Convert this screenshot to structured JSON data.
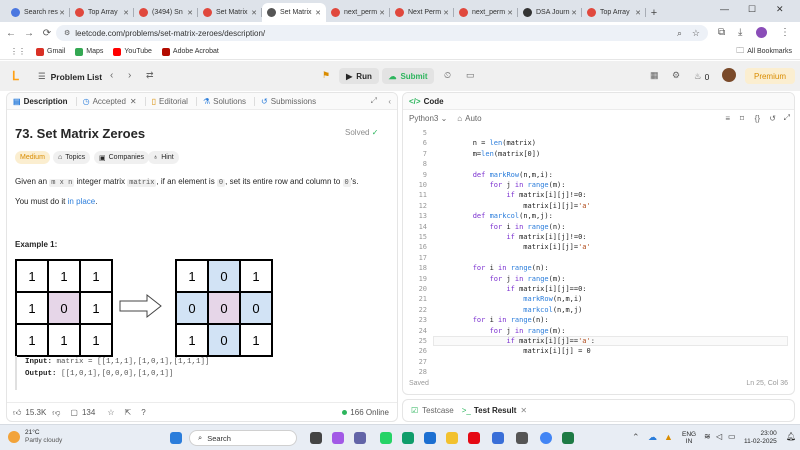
{
  "browser": {
    "tabs": [
      {
        "label": "Search res",
        "color": "#4a77e0"
      },
      {
        "label": "Top Array",
        "color": "#e0483d"
      },
      {
        "label": "(3494) Sn",
        "color": "#e0483d"
      },
      {
        "label": "Set Matrix",
        "color": "#e0483d"
      },
      {
        "label": "Set Matrix",
        "color": "#555555"
      },
      {
        "label": "next_perm",
        "color": "#e0483d"
      },
      {
        "label": "Next Perm",
        "color": "#e0483d"
      },
      {
        "label": "next_perm",
        "color": "#e0483d"
      },
      {
        "label": "DSA Journ",
        "color": "#333333"
      },
      {
        "label": "Top Array",
        "color": "#e0483d"
      }
    ],
    "active_tab_index": 4,
    "url": "leetcode.com/problems/set-matrix-zeroes/description/",
    "bookmarks": [
      {
        "label": "Gmail",
        "color": "#d93025"
      },
      {
        "label": "Maps",
        "color": "#34a853"
      },
      {
        "label": "YouTube",
        "color": "#ff0000"
      },
      {
        "label": "Adobe Acrobat",
        "color": "#b30b00"
      }
    ],
    "all_bookmarks": "All Bookmarks"
  },
  "lc_nav": {
    "problem_list": "Problem List",
    "run": "Run",
    "submit": "Submit",
    "fire_count": "0",
    "premium": "Premium"
  },
  "left": {
    "tabs": [
      "Description",
      "Accepted",
      "Editorial",
      "Solutions",
      "Submissions"
    ],
    "title": "73. Set Matrix Zeroes",
    "solved": "Solved",
    "chips": [
      "Medium",
      "Topics",
      "Companies",
      "Hint"
    ],
    "desc_1": "Given an",
    "desc_mxn": "m x n",
    "desc_2": "integer matrix",
    "desc_matrix": "matrix",
    "desc_3": ", if an element is",
    "desc_zero": "0",
    "desc_4": ", set its entire row and column to",
    "desc_zero2": "0",
    "desc_5": "'s.",
    "inplace_1": "You must do it",
    "inplace_link": "in place",
    "inplace_2": ".",
    "example_title": "Example 1:",
    "input_grid": [
      [
        "1",
        "1",
        "1"
      ],
      [
        "1",
        "0",
        "1"
      ],
      [
        "1",
        "1",
        "1"
      ]
    ],
    "output_grid": [
      [
        "1",
        "0",
        "1"
      ],
      [
        "0",
        "0",
        "0"
      ],
      [
        "1",
        "0",
        "1"
      ]
    ],
    "input_label": "Input:",
    "input_value": "matrix = [[1,1,1],[1,0,1],[1,1,1]]",
    "output_label": "Output:",
    "output_value": "[[1,0,1],[0,0,0],[1,0,1]]",
    "likes": "15.3K",
    "comments": "134",
    "online": "166 Online"
  },
  "right": {
    "code_tab": "Code",
    "language": "Python3",
    "auto": "Auto",
    "code_lines": [
      {
        "n": "5",
        "t": ""
      },
      {
        "n": "6",
        "t": "        n = len(matrix)"
      },
      {
        "n": "7",
        "t": "        m=len(matrix[0])"
      },
      {
        "n": "8",
        "t": ""
      },
      {
        "n": "9",
        "t": "        def markRow(n,m,i):"
      },
      {
        "n": "10",
        "t": "            for j in range(m):"
      },
      {
        "n": "11",
        "t": "                if matrix[i][j]!=0:"
      },
      {
        "n": "12",
        "t": "                    matrix[i][j]='a'"
      },
      {
        "n": "13",
        "t": "        def markcol(n,m,j):"
      },
      {
        "n": "14",
        "t": "            for i in range(n):"
      },
      {
        "n": "15",
        "t": "                if matrix[i][j]!=0:"
      },
      {
        "n": "16",
        "t": "                    matrix[i][j]='a'"
      },
      {
        "n": "17",
        "t": ""
      },
      {
        "n": "18",
        "t": "        for i in range(n):"
      },
      {
        "n": "19",
        "t": "            for j in range(m):"
      },
      {
        "n": "20",
        "t": "                if matrix[i][j]==0:"
      },
      {
        "n": "21",
        "t": "                    markRow(n,m,i)"
      },
      {
        "n": "22",
        "t": "                    markcol(n,m,j)"
      },
      {
        "n": "23",
        "t": "        for i in range(n):"
      },
      {
        "n": "24",
        "t": "            for j in range(m):"
      },
      {
        "n": "25",
        "t": "                if matrix[i][j]=='a':"
      },
      {
        "n": "26",
        "t": "                    matrix[i][j] = 0"
      },
      {
        "n": "27",
        "t": ""
      },
      {
        "n": "28",
        "t": ""
      }
    ],
    "current_line": "25",
    "saved": "Saved",
    "cursor": "Ln 25, Col 36",
    "testcase": "Testcase",
    "test_result": "Test Result"
  },
  "taskbar": {
    "weather_temp": "21°C",
    "weather_desc": "Partly cloudy",
    "search": "Search",
    "lang_1": "ENG",
    "lang_2": "IN",
    "time": "23:00",
    "date": "11-02-2025"
  }
}
